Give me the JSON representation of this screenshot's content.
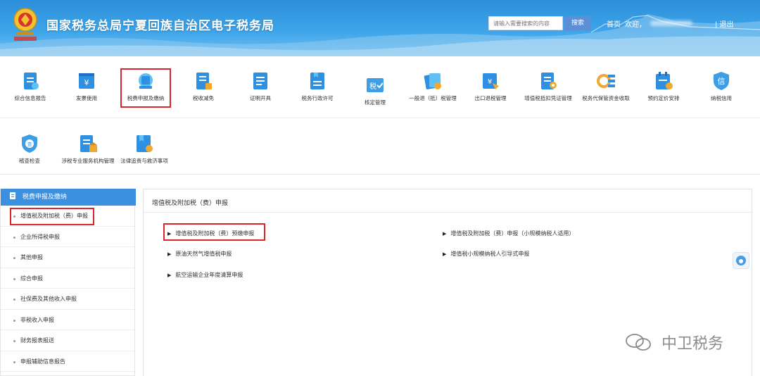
{
  "header": {
    "title": "国家税务总局宁夏回族自治区电子税务局",
    "search_placeholder": "请输入需要搜索的内容",
    "search_label": "搜索",
    "home_label": "首页",
    "welcome_label": "欢迎，",
    "logout_label": "| 退出"
  },
  "icons_row1": [
    {
      "label": "综合信息报告",
      "icon": "report-icon"
    },
    {
      "label": "发票使用",
      "icon": "invoice-icon"
    },
    {
      "label": "税费申报及缴纳",
      "icon": "tax-declare-icon"
    },
    {
      "label": "税收减免",
      "icon": "tax-reduction-icon"
    },
    {
      "label": "证明开具",
      "icon": "certificate-icon"
    },
    {
      "label": "税务行政许可",
      "icon": "permit-icon"
    },
    {
      "label": "核定管理",
      "icon": "verify-icon"
    },
    {
      "label": "一般退（抵）税管理",
      "icon": "refund-icon"
    },
    {
      "label": "出口退税管理",
      "icon": "export-refund-icon"
    },
    {
      "label": "增值税抵扣凭证管理",
      "icon": "vat-voucher-icon"
    },
    {
      "label": "税务代保管资金收取",
      "icon": "custody-fund-icon"
    },
    {
      "label": "预约定价安排",
      "icon": "pricing-icon"
    },
    {
      "label": "纳税信用",
      "icon": "credit-icon"
    }
  ],
  "icons_row2": [
    {
      "label": "稽查检查",
      "icon": "inspection-icon"
    },
    {
      "label": "涉税专业服务机构管理",
      "icon": "agency-icon"
    },
    {
      "label": "法律追责与救济事项",
      "icon": "legal-icon"
    }
  ],
  "icon_glyphs": {
    "tax": "税",
    "credit": "信",
    "inspect": "查",
    "yen": "¥"
  },
  "sidebar": {
    "header": "税费申报及缴纳",
    "items": [
      "增值税及附加税（费）申报",
      "企业所得税申报",
      "其他申报",
      "综合申报",
      "社保费及其他收入申报",
      "非税收入申报",
      "财务报表报送",
      "申报辅助信息报告"
    ]
  },
  "content": {
    "title": "增值税及附加税（费）申报",
    "links_left": [
      "增值税及附加税（费）预缴申报",
      "原油天然气增值税申报",
      "航空运输企业年度清算申报"
    ],
    "links_right": [
      "增值税及附加税（费）申报（小规模纳税人适用）",
      "增值税小规模纳税人引导式申报"
    ]
  },
  "watermark": "中卫税务",
  "colors": {
    "accent": "#3d8fe0",
    "highlight": "#d9262c",
    "icon_blue": "#2f8fe0"
  }
}
